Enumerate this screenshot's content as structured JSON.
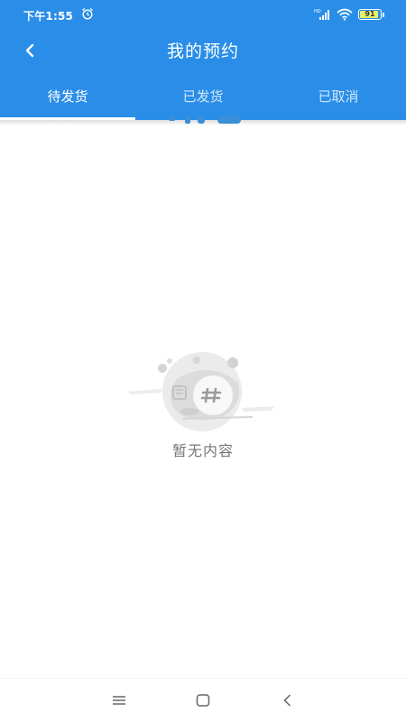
{
  "status_bar": {
    "time": "下午1:55",
    "battery_level": "91"
  },
  "header": {
    "title": "我的预约"
  },
  "tabs": [
    {
      "label": "待发货"
    },
    {
      "label": "已发货"
    },
    {
      "label": "已取消"
    }
  ],
  "empty_state": {
    "message": "暂无内容"
  },
  "colors": {
    "primary": "#2a8ee8",
    "text_muted": "#777777"
  }
}
